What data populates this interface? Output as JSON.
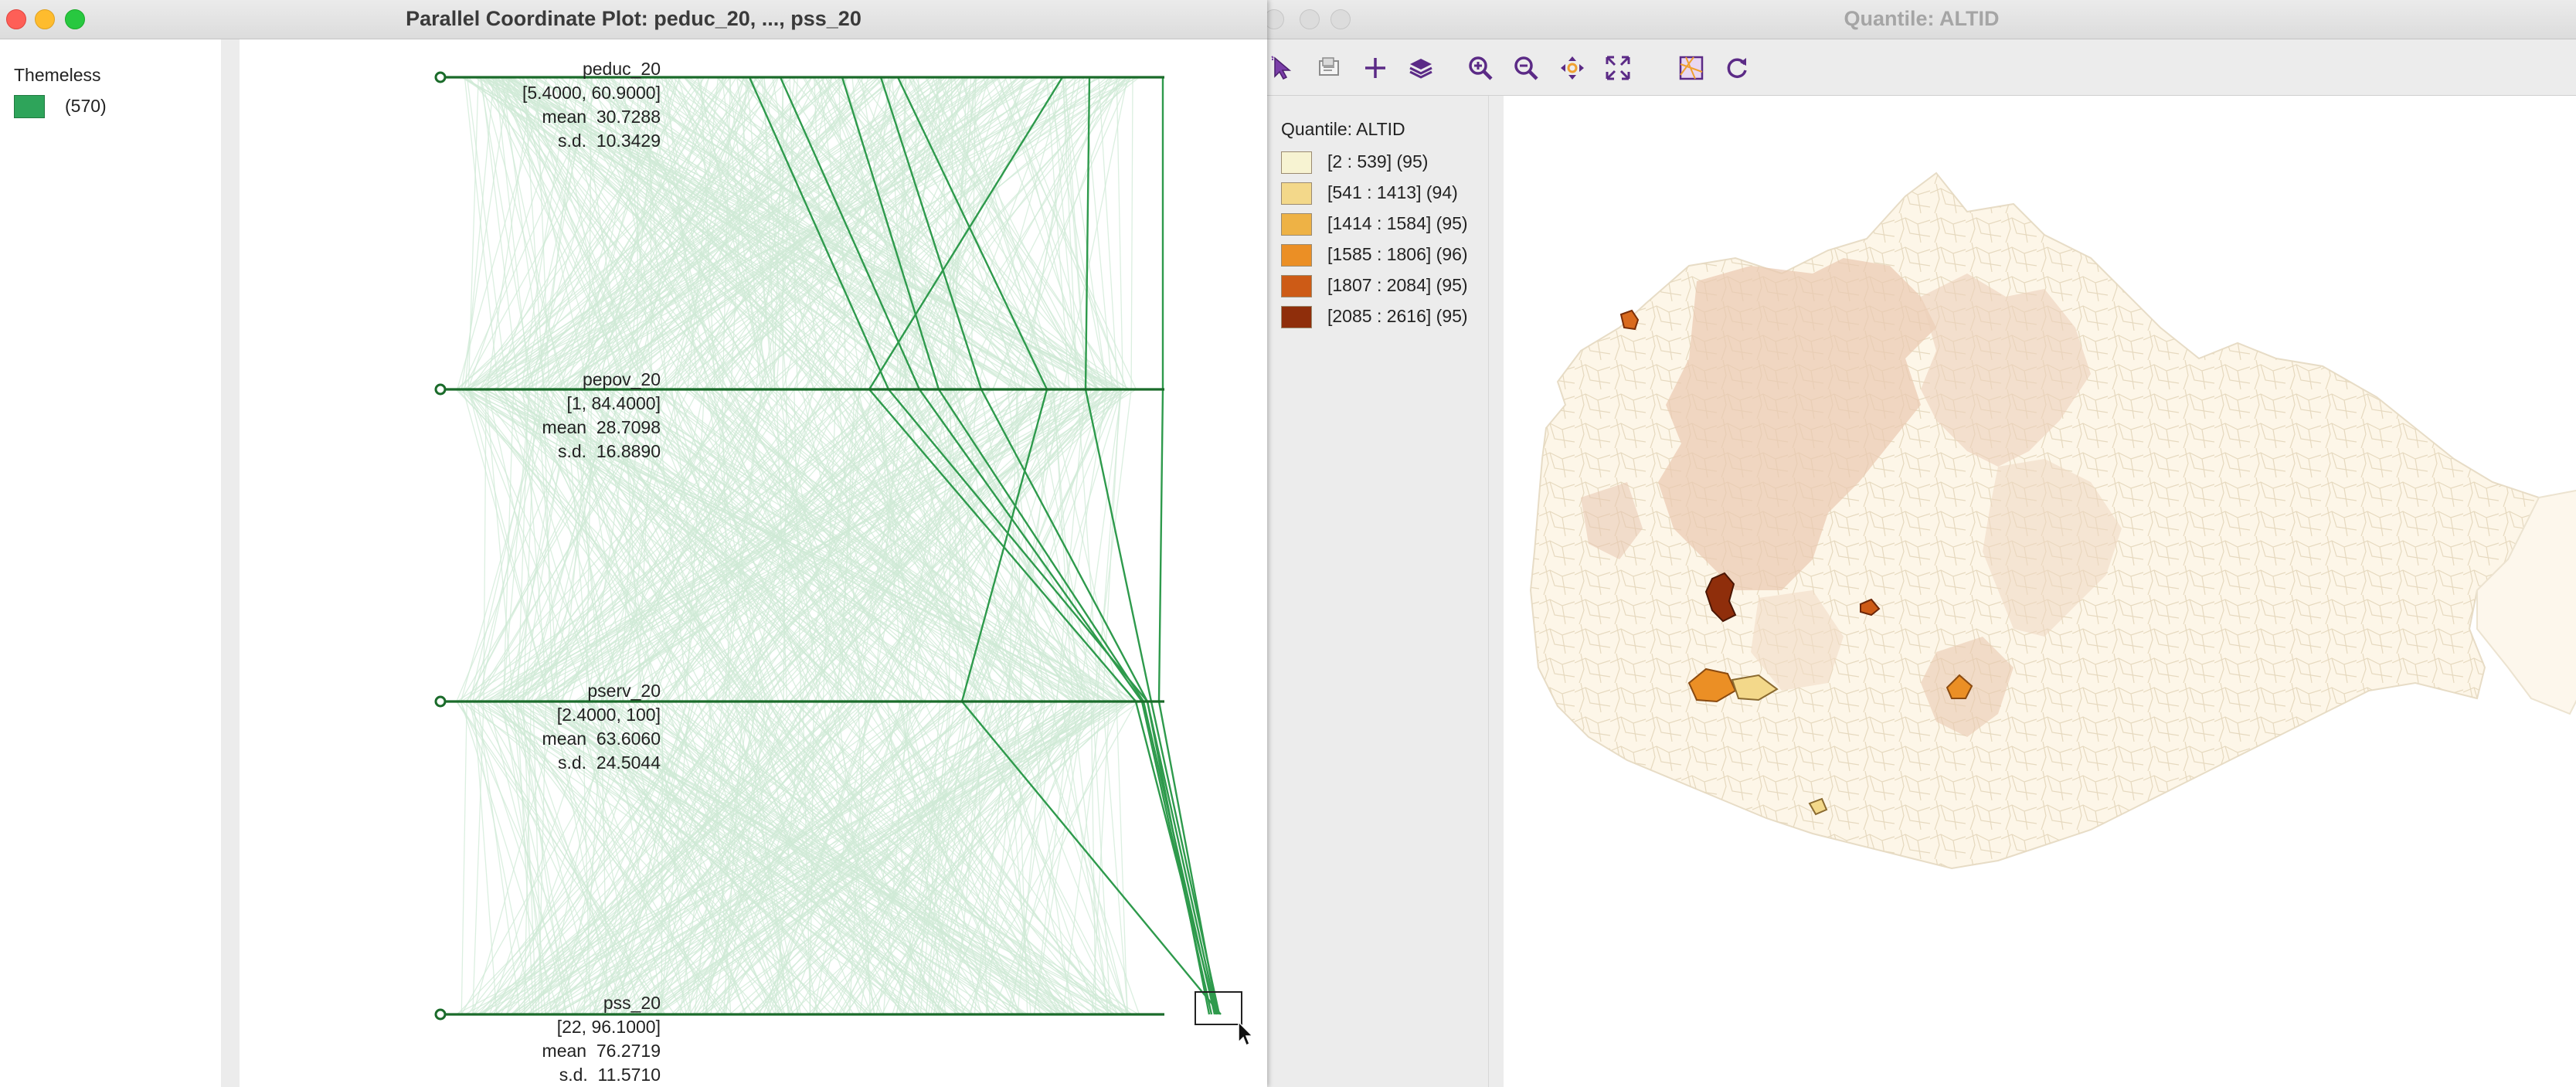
{
  "pcp_window": {
    "title": "Parallel Coordinate Plot: peduc_20, ..., pss_20",
    "legend": {
      "title": "Themeless",
      "count": "(570)",
      "color": "#2ea45a"
    },
    "axes": [
      {
        "name": "peduc_20",
        "range": "[5.4000, 60.9000]",
        "mean": "mean  30.7288",
        "sd": "s.d.  10.3429"
      },
      {
        "name": "pepov_20",
        "range": "[1, 84.4000]",
        "mean": "mean  28.7098",
        "sd": "s.d.  16.8890"
      },
      {
        "name": "pserv_20",
        "range": "[2.4000, 100]",
        "mean": "mean  63.6060",
        "sd": "s.d.  24.5044"
      },
      {
        "name": "pss_20",
        "range": "[22, 96.1000]",
        "mean": "mean  76.2719",
        "sd": "s.d.  11.5710"
      }
    ],
    "colors": {
      "axis": "#1a6b2a",
      "background_lines": "#cfe9d6",
      "selected_lines": "#2e9a4c"
    }
  },
  "map_window": {
    "title": "Quantile: ALTID",
    "toolbar": [
      "select-tool-icon",
      "select-by-map-icon",
      "add-layer-icon",
      "layers-icon",
      "zoom-in-icon",
      "zoom-out-icon",
      "pan-icon",
      "full-extent-icon",
      "basemap-icon",
      "refresh-icon"
    ],
    "legend": {
      "title": "Quantile: ALTID",
      "items": [
        {
          "label": "[2 : 539] (95)",
          "color": "#f7f3d2"
        },
        {
          "label": "[541 : 1413] (94)",
          "color": "#f3d88a"
        },
        {
          "label": "[1414 : 1584] (95)",
          "color": "#eeb245"
        },
        {
          "label": "[1585 : 1806] (96)",
          "color": "#eb8f25"
        },
        {
          "label": "[1807 : 2084] (95)",
          "color": "#cd5b16"
        },
        {
          "label": "[2085 : 2616] (95)",
          "color": "#8f2e0b"
        }
      ]
    }
  }
}
